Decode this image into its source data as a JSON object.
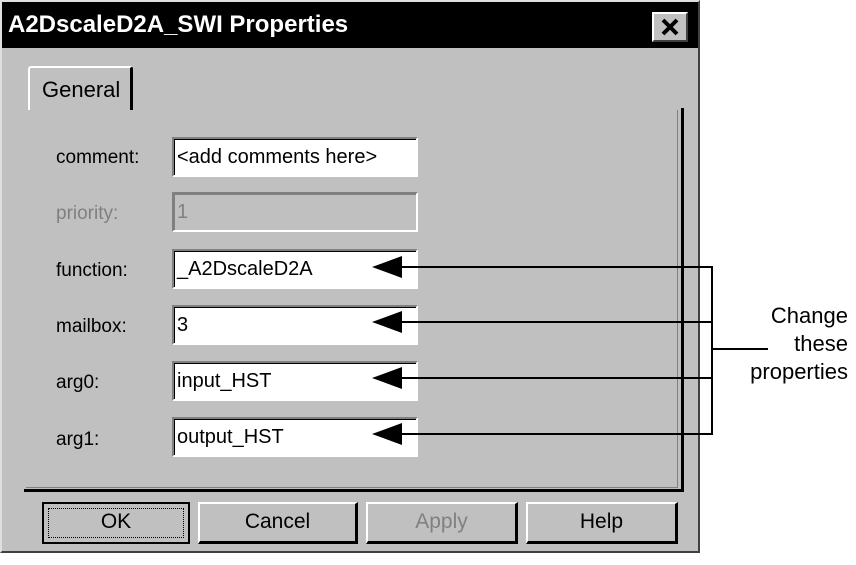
{
  "window": {
    "title": "A2DscaleD2A_SWI Properties",
    "close_icon": "close-x-icon"
  },
  "tabs": [
    {
      "label": "General"
    }
  ],
  "fields": {
    "comment": {
      "label": "comment:",
      "value": "<add comments here>"
    },
    "priority": {
      "label": "priority:",
      "value": "1",
      "disabled": true
    },
    "function": {
      "label": "function:",
      "value": "_A2DscaleD2A"
    },
    "mailbox": {
      "label": "mailbox:",
      "value": "3"
    },
    "arg0": {
      "label": "arg0:",
      "value": "input_HST"
    },
    "arg1": {
      "label": "arg1:",
      "value": "output_HST"
    }
  },
  "buttons": {
    "ok": "OK",
    "cancel": "Cancel",
    "apply": "Apply",
    "apply_disabled": true,
    "help": "Help"
  },
  "annotation": {
    "lines": [
      "Change",
      "these",
      "properties"
    ],
    "arrow_icon": "left-arrow-icon"
  },
  "colors": {
    "dialog_face": "#c0c0c0",
    "titlebar": "#000000",
    "title_text": "#ffffff",
    "disabled_text": "#808080"
  }
}
